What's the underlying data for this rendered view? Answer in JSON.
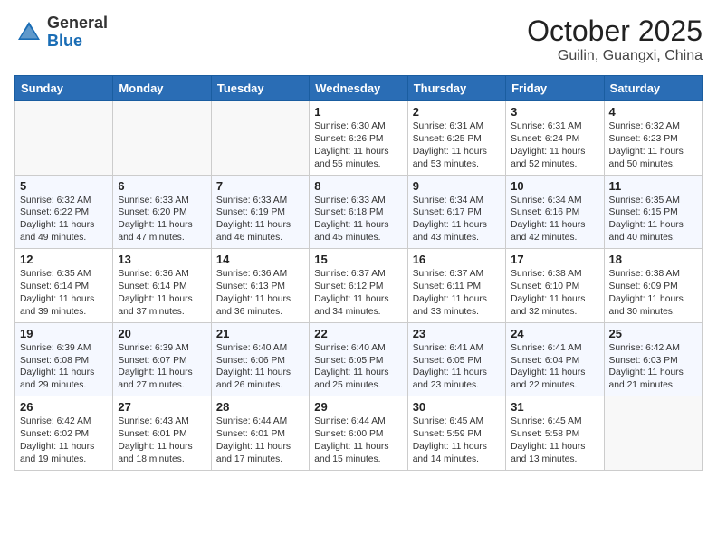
{
  "header": {
    "logo_general": "General",
    "logo_blue": "Blue",
    "title": "October 2025",
    "subtitle": "Guilin, Guangxi, China"
  },
  "days_of_week": [
    "Sunday",
    "Monday",
    "Tuesday",
    "Wednesday",
    "Thursday",
    "Friday",
    "Saturday"
  ],
  "weeks": [
    [
      {
        "num": "",
        "sunrise": "",
        "sunset": "",
        "daylight": "",
        "empty": true
      },
      {
        "num": "",
        "sunrise": "",
        "sunset": "",
        "daylight": "",
        "empty": true
      },
      {
        "num": "",
        "sunrise": "",
        "sunset": "",
        "daylight": "",
        "empty": true
      },
      {
        "num": "1",
        "sunrise": "6:30 AM",
        "sunset": "6:26 PM",
        "daylight": "11 hours and 55 minutes."
      },
      {
        "num": "2",
        "sunrise": "6:31 AM",
        "sunset": "6:25 PM",
        "daylight": "11 hours and 53 minutes."
      },
      {
        "num": "3",
        "sunrise": "6:31 AM",
        "sunset": "6:24 PM",
        "daylight": "11 hours and 52 minutes."
      },
      {
        "num": "4",
        "sunrise": "6:32 AM",
        "sunset": "6:23 PM",
        "daylight": "11 hours and 50 minutes."
      }
    ],
    [
      {
        "num": "5",
        "sunrise": "6:32 AM",
        "sunset": "6:22 PM",
        "daylight": "11 hours and 49 minutes."
      },
      {
        "num": "6",
        "sunrise": "6:33 AM",
        "sunset": "6:20 PM",
        "daylight": "11 hours and 47 minutes."
      },
      {
        "num": "7",
        "sunrise": "6:33 AM",
        "sunset": "6:19 PM",
        "daylight": "11 hours and 46 minutes."
      },
      {
        "num": "8",
        "sunrise": "6:33 AM",
        "sunset": "6:18 PM",
        "daylight": "11 hours and 45 minutes."
      },
      {
        "num": "9",
        "sunrise": "6:34 AM",
        "sunset": "6:17 PM",
        "daylight": "11 hours and 43 minutes."
      },
      {
        "num": "10",
        "sunrise": "6:34 AM",
        "sunset": "6:16 PM",
        "daylight": "11 hours and 42 minutes."
      },
      {
        "num": "11",
        "sunrise": "6:35 AM",
        "sunset": "6:15 PM",
        "daylight": "11 hours and 40 minutes."
      }
    ],
    [
      {
        "num": "12",
        "sunrise": "6:35 AM",
        "sunset": "6:14 PM",
        "daylight": "11 hours and 39 minutes."
      },
      {
        "num": "13",
        "sunrise": "6:36 AM",
        "sunset": "6:14 PM",
        "daylight": "11 hours and 37 minutes."
      },
      {
        "num": "14",
        "sunrise": "6:36 AM",
        "sunset": "6:13 PM",
        "daylight": "11 hours and 36 minutes."
      },
      {
        "num": "15",
        "sunrise": "6:37 AM",
        "sunset": "6:12 PM",
        "daylight": "11 hours and 34 minutes."
      },
      {
        "num": "16",
        "sunrise": "6:37 AM",
        "sunset": "6:11 PM",
        "daylight": "11 hours and 33 minutes."
      },
      {
        "num": "17",
        "sunrise": "6:38 AM",
        "sunset": "6:10 PM",
        "daylight": "11 hours and 32 minutes."
      },
      {
        "num": "18",
        "sunrise": "6:38 AM",
        "sunset": "6:09 PM",
        "daylight": "11 hours and 30 minutes."
      }
    ],
    [
      {
        "num": "19",
        "sunrise": "6:39 AM",
        "sunset": "6:08 PM",
        "daylight": "11 hours and 29 minutes."
      },
      {
        "num": "20",
        "sunrise": "6:39 AM",
        "sunset": "6:07 PM",
        "daylight": "11 hours and 27 minutes."
      },
      {
        "num": "21",
        "sunrise": "6:40 AM",
        "sunset": "6:06 PM",
        "daylight": "11 hours and 26 minutes."
      },
      {
        "num": "22",
        "sunrise": "6:40 AM",
        "sunset": "6:05 PM",
        "daylight": "11 hours and 25 minutes."
      },
      {
        "num": "23",
        "sunrise": "6:41 AM",
        "sunset": "6:05 PM",
        "daylight": "11 hours and 23 minutes."
      },
      {
        "num": "24",
        "sunrise": "6:41 AM",
        "sunset": "6:04 PM",
        "daylight": "11 hours and 22 minutes."
      },
      {
        "num": "25",
        "sunrise": "6:42 AM",
        "sunset": "6:03 PM",
        "daylight": "11 hours and 21 minutes."
      }
    ],
    [
      {
        "num": "26",
        "sunrise": "6:42 AM",
        "sunset": "6:02 PM",
        "daylight": "11 hours and 19 minutes."
      },
      {
        "num": "27",
        "sunrise": "6:43 AM",
        "sunset": "6:01 PM",
        "daylight": "11 hours and 18 minutes."
      },
      {
        "num": "28",
        "sunrise": "6:44 AM",
        "sunset": "6:01 PM",
        "daylight": "11 hours and 17 minutes."
      },
      {
        "num": "29",
        "sunrise": "6:44 AM",
        "sunset": "6:00 PM",
        "daylight": "11 hours and 15 minutes."
      },
      {
        "num": "30",
        "sunrise": "6:45 AM",
        "sunset": "5:59 PM",
        "daylight": "11 hours and 14 minutes."
      },
      {
        "num": "31",
        "sunrise": "6:45 AM",
        "sunset": "5:58 PM",
        "daylight": "11 hours and 13 minutes."
      },
      {
        "num": "",
        "sunrise": "",
        "sunset": "",
        "daylight": "",
        "empty": true
      }
    ]
  ],
  "labels": {
    "sunrise": "Sunrise:",
    "sunset": "Sunset:",
    "daylight": "Daylight:"
  }
}
